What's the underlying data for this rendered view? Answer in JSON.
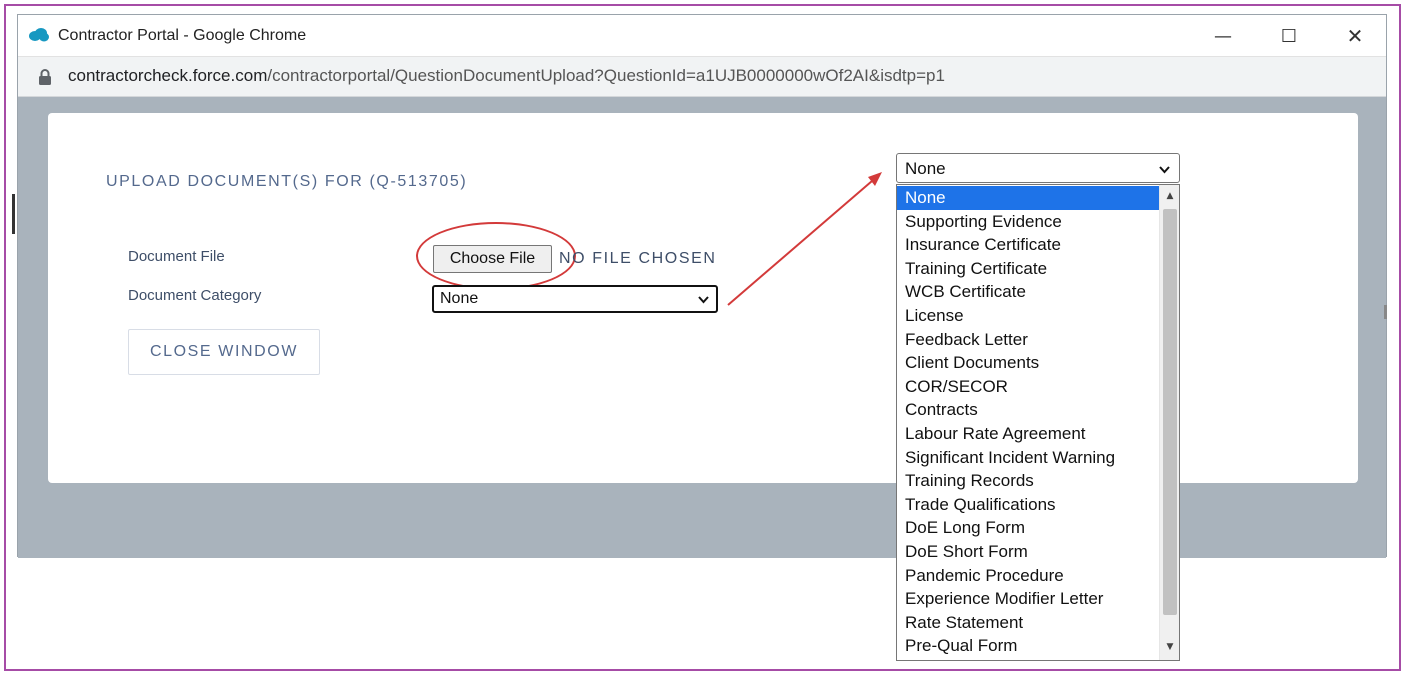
{
  "window": {
    "title": "Contractor Portal - Google Chrome",
    "minimize_glyph": "—",
    "maximize_glyph": "☐",
    "close_glyph": "✕"
  },
  "address_bar": {
    "url_host": "contractorcheck.force.com",
    "url_path": "/contractorportal/QuestionDocumentUpload?QuestionId=a1UJB0000000wOf2AI&isdtp=p1"
  },
  "form": {
    "title": "UPLOAD DOCUMENT(S) FOR (Q-513705)",
    "document_file_label": "Document File",
    "choose_file_label": "Choose File",
    "no_file_text": "NO FILE CHOSEN",
    "document_category_label": "Document Category",
    "category_value": "None",
    "close_window_label": "CLOSE WINDOW"
  },
  "dropdown": {
    "selected_value": "None",
    "options": [
      "None",
      "Supporting Evidence",
      "Insurance Certificate",
      "Training Certificate",
      "WCB Certificate",
      "License",
      "Feedback Letter",
      "Client Documents",
      "COR/SECOR",
      "Contracts",
      "Labour Rate Agreement",
      "Significant Incident Warning",
      "Training Records",
      "Trade Qualifications",
      "DoE Long Form",
      "DoE Short Form",
      "Pandemic Procedure",
      "Experience Modifier Letter",
      "Rate Statement",
      "Pre-Qual Form"
    ]
  },
  "colors": {
    "frame_border": "#a64ca6",
    "annotation_red": "#d33a3a",
    "selected_option": "#1e73e8",
    "label_text": "#54698d",
    "page_background": "#a9b3bc"
  }
}
